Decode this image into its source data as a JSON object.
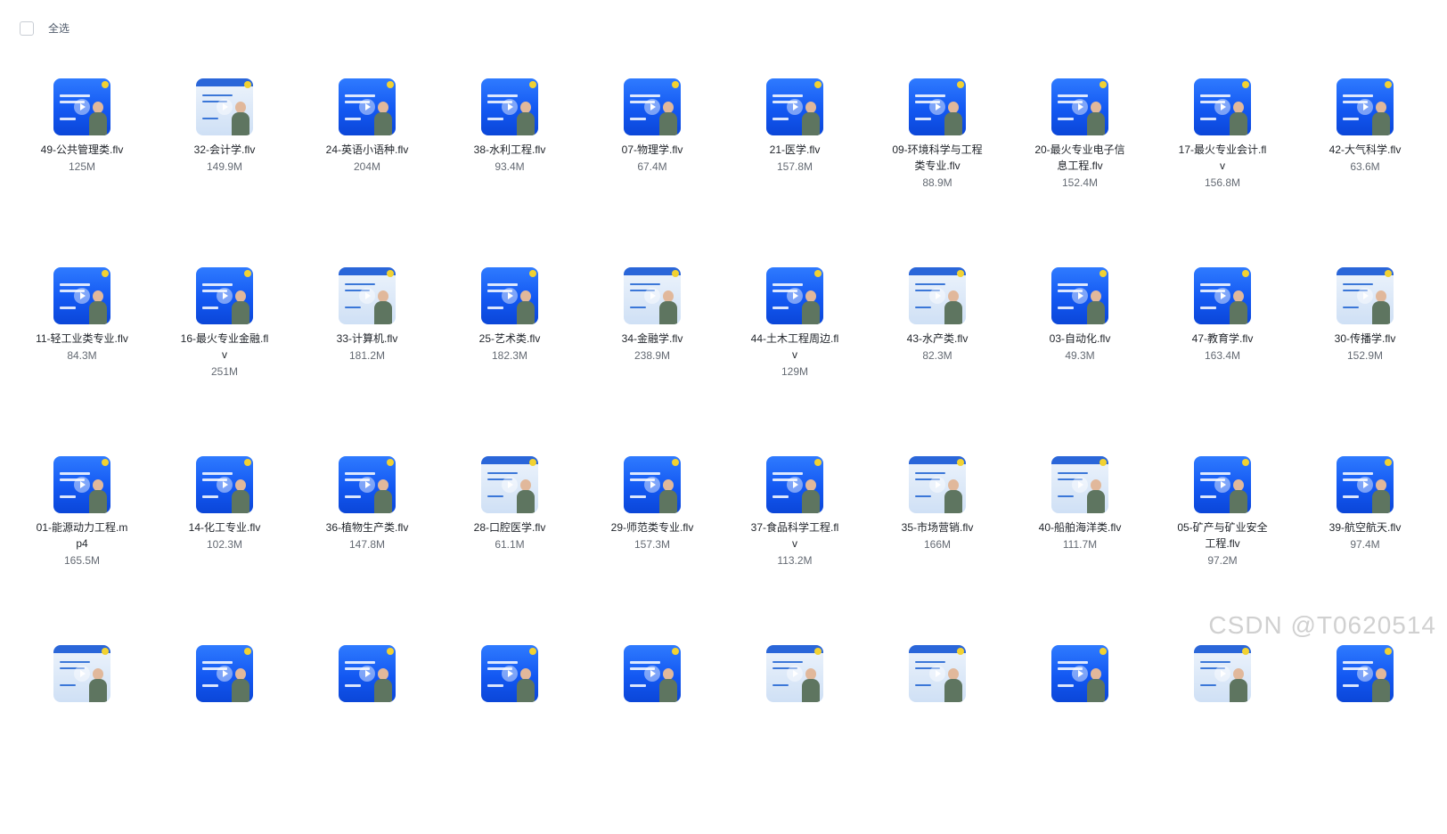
{
  "toolbar": {
    "select_all_label": "全选"
  },
  "files": [
    {
      "name": "49-公共管理类.flv",
      "size": "125M",
      "thumb": "blue"
    },
    {
      "name": "32-会计学.flv",
      "size": "149.9M",
      "thumb": "light"
    },
    {
      "name": "24-英语小语种.flv",
      "size": "204M",
      "thumb": "blue"
    },
    {
      "name": "38-水利工程.flv",
      "size": "93.4M",
      "thumb": "blue"
    },
    {
      "name": "07-物理学.flv",
      "size": "67.4M",
      "thumb": "blue"
    },
    {
      "name": "21-医学.flv",
      "size": "157.8M",
      "thumb": "blue"
    },
    {
      "name": "09-环境科学与工程类专业.flv",
      "size": "88.9M",
      "thumb": "blue"
    },
    {
      "name": "20-最火专业电子信息工程.flv",
      "size": "152.4M",
      "thumb": "blue"
    },
    {
      "name": "17-最火专业会计.flv",
      "size": "156.8M",
      "thumb": "blue"
    },
    {
      "name": "42-大气科学.flv",
      "size": "63.6M",
      "thumb": "blue"
    },
    {
      "name": "11-轻工业类专业.flv",
      "size": "84.3M",
      "thumb": "blue"
    },
    {
      "name": "16-最火专业金融.flv",
      "size": "251M",
      "thumb": "blue"
    },
    {
      "name": "33-计算机.flv",
      "size": "181.2M",
      "thumb": "light"
    },
    {
      "name": "25-艺术类.flv",
      "size": "182.3M",
      "thumb": "blue"
    },
    {
      "name": "34-金融学.flv",
      "size": "238.9M",
      "thumb": "light"
    },
    {
      "name": "44-土木工程周边.flv",
      "size": "129M",
      "thumb": "blue"
    },
    {
      "name": "43-水产类.flv",
      "size": "82.3M",
      "thumb": "light"
    },
    {
      "name": "03-自动化.flv",
      "size": "49.3M",
      "thumb": "blue"
    },
    {
      "name": "47-教育学.flv",
      "size": "163.4M",
      "thumb": "blue"
    },
    {
      "name": "30-传播学.flv",
      "size": "152.9M",
      "thumb": "light"
    },
    {
      "name": "01-能源动力工程.mp4",
      "size": "165.5M",
      "thumb": "blue"
    },
    {
      "name": "14-化工专业.flv",
      "size": "102.3M",
      "thumb": "blue"
    },
    {
      "name": "36-植物生产类.flv",
      "size": "147.8M",
      "thumb": "blue"
    },
    {
      "name": "28-口腔医学.flv",
      "size": "61.1M",
      "thumb": "light"
    },
    {
      "name": "29-师范类专业.flv",
      "size": "157.3M",
      "thumb": "blue"
    },
    {
      "name": "37-食品科学工程.flv",
      "size": "113.2M",
      "thumb": "blue"
    },
    {
      "name": "35-市场营销.flv",
      "size": "166M",
      "thumb": "light"
    },
    {
      "name": "40-船舶海洋类.flv",
      "size": "111.7M",
      "thumb": "light"
    },
    {
      "name": "05-矿产与矿业安全工程.flv",
      "size": "97.2M",
      "thumb": "blue"
    },
    {
      "name": "39-航空航天.flv",
      "size": "97.4M",
      "thumb": "blue"
    },
    {
      "name": "",
      "size": "",
      "thumb": "light"
    },
    {
      "name": "",
      "size": "",
      "thumb": "blue"
    },
    {
      "name": "",
      "size": "",
      "thumb": "blue"
    },
    {
      "name": "",
      "size": "",
      "thumb": "blue"
    },
    {
      "name": "",
      "size": "",
      "thumb": "blue"
    },
    {
      "name": "",
      "size": "",
      "thumb": "light"
    },
    {
      "name": "",
      "size": "",
      "thumb": "light"
    },
    {
      "name": "",
      "size": "",
      "thumb": "blue"
    },
    {
      "name": "",
      "size": "",
      "thumb": "light"
    },
    {
      "name": "",
      "size": "",
      "thumb": "blue"
    }
  ],
  "watermark": "CSDN @T0620514"
}
